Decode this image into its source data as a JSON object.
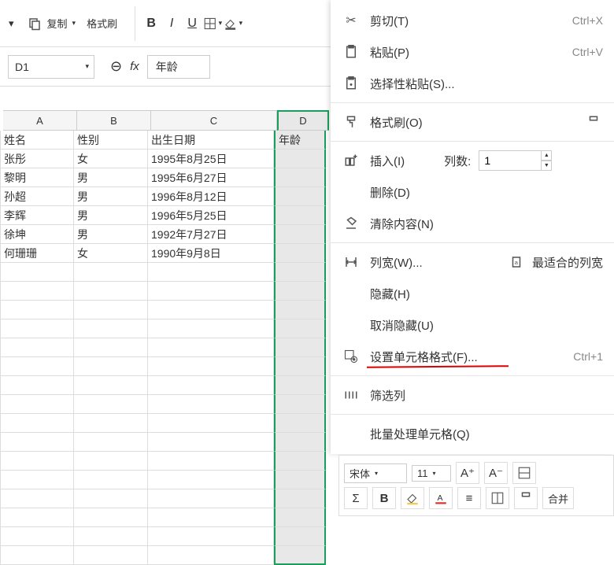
{
  "toolbar": {
    "paste_tail": "▾",
    "copy_label": "复制",
    "format_painter_label": "格式刷"
  },
  "formula": {
    "name_box": "D1",
    "fx": "fx",
    "value": "年龄"
  },
  "columns": [
    "A",
    "B",
    "C",
    "D"
  ],
  "table": {
    "headers": {
      "name": "姓名",
      "gender": "性别",
      "birth": "出生日期",
      "age": "年龄"
    },
    "rows": [
      {
        "name": "张彤",
        "gender": "女",
        "birth": "1995年8月25日"
      },
      {
        "name": "黎明",
        "gender": "男",
        "birth": "1995年6月27日"
      },
      {
        "name": "孙超",
        "gender": "男",
        "birth": "1996年8月12日"
      },
      {
        "name": "李辉",
        "gender": "男",
        "birth": "1996年5月25日"
      },
      {
        "name": "徐坤",
        "gender": "男",
        "birth": "1992年7月27日"
      },
      {
        "name": "何珊珊",
        "gender": "女",
        "birth": "1990年9月8日"
      }
    ]
  },
  "context": {
    "cut": "剪切(T)",
    "cut_sc": "Ctrl+X",
    "paste": "粘贴(P)",
    "paste_sc": "Ctrl+V",
    "paste_special": "选择性粘贴(S)...",
    "format_painter": "格式刷(O)",
    "insert": "插入(I)",
    "insert_cols_label": "列数:",
    "insert_cols_value": "1",
    "delete": "删除(D)",
    "clear": "清除内容(N)",
    "col_width": "列宽(W)...",
    "best_fit": "最适合的列宽",
    "hide": "隐藏(H)",
    "unhide": "取消隐藏(U)",
    "format_cells": "设置单元格格式(F)...",
    "format_cells_sc": "Ctrl+1",
    "filter": "筛选列",
    "batch": "批量处理单元格(Q)"
  },
  "mini": {
    "font": "宋体",
    "size": "11",
    "merge": "合并"
  }
}
